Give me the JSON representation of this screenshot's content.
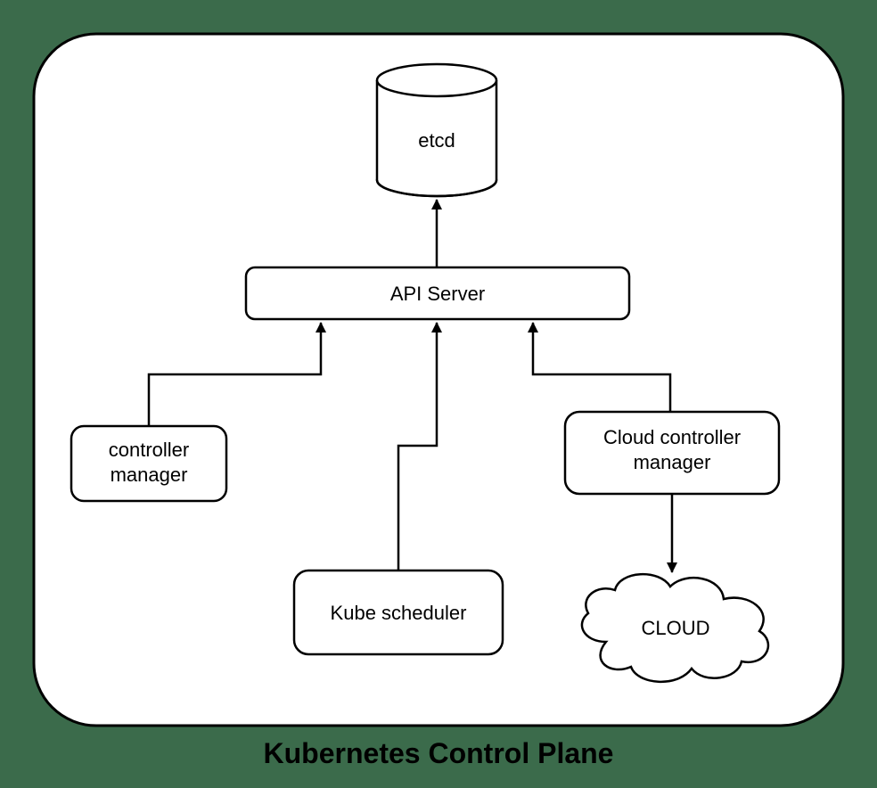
{
  "title": "Kubernetes Control Plane",
  "nodes": {
    "etcd": {
      "label": "etcd"
    },
    "api_server": {
      "label": "API Server"
    },
    "controller_manager": {
      "label_line1": "controller",
      "label_line2": "manager"
    },
    "kube_scheduler": {
      "label": "Kube scheduler"
    },
    "cloud_controller_manager": {
      "label_line1": "Cloud controller",
      "label_line2": "manager"
    },
    "cloud": {
      "label": "CLOUD"
    }
  },
  "edges": [
    {
      "from": "api_server",
      "to": "etcd",
      "direction": "up"
    },
    {
      "from": "controller_manager",
      "to": "api_server",
      "direction": "up"
    },
    {
      "from": "kube_scheduler",
      "to": "api_server",
      "direction": "up"
    },
    {
      "from": "cloud_controller_manager",
      "to": "api_server",
      "direction": "up"
    },
    {
      "from": "cloud_controller_manager",
      "to": "cloud",
      "direction": "down"
    }
  ]
}
